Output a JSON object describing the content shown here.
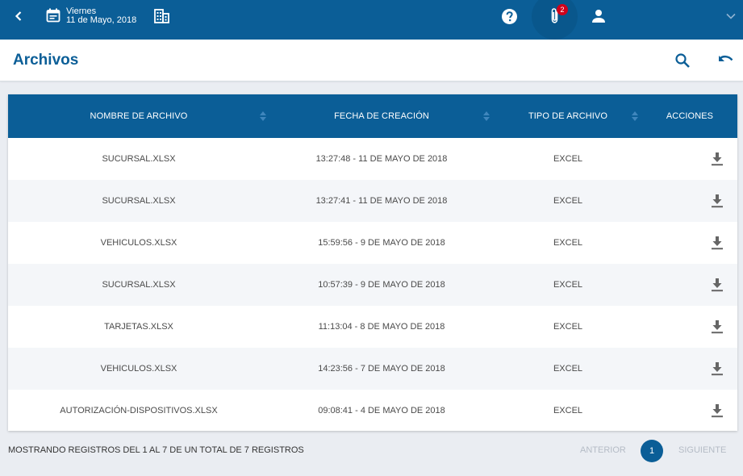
{
  "header": {
    "day": "Viernes",
    "date": "11 de Mayo, 2018",
    "attachments_badge": "2",
    "icons": [
      "back-icon",
      "calendar-icon",
      "building-icon",
      "help-icon",
      "paperclip-icon",
      "user-icon",
      "chevron-down-icon"
    ]
  },
  "page": {
    "title": "Archivos",
    "actions": [
      "search-icon",
      "undo-icon"
    ]
  },
  "table": {
    "columns": [
      "NOMBRE DE ARCHIVO",
      "FECHA DE CREACIÓN",
      "TIPO DE ARCHIVO",
      "ACCIONES"
    ],
    "rows": [
      {
        "name": "SUCURSAL.XLSX",
        "date": "13:27:48 - 11 DE MAYO DE 2018",
        "type": "EXCEL"
      },
      {
        "name": "SUCURSAL.XLSX",
        "date": "13:27:41 - 11 DE MAYO DE 2018",
        "type": "EXCEL"
      },
      {
        "name": "VEHICULOS.XLSX",
        "date": "15:59:56 - 9 DE MAYO DE 2018",
        "type": "EXCEL"
      },
      {
        "name": "SUCURSAL.XLSX",
        "date": "10:57:39 - 9 DE MAYO DE 2018",
        "type": "EXCEL"
      },
      {
        "name": "TARJETAS.XLSX",
        "date": "11:13:04 - 8 DE MAYO DE 2018",
        "type": "EXCEL"
      },
      {
        "name": "VEHICULOS.XLSX",
        "date": "14:23:56 - 7 DE MAYO DE 2018",
        "type": "EXCEL"
      },
      {
        "name": "AUTORIZACIÓN-DISPOSITIVOS.XLSX",
        "date": "09:08:41 - 4 DE MAYO DE 2018",
        "type": "EXCEL"
      }
    ]
  },
  "footer": {
    "info": "MOSTRANDO REGISTROS DEL 1 AL 7 DE UN TOTAL DE 7 REGISTROS",
    "prev": "ANTERIOR",
    "page": "1",
    "next": "SIGUIENTE"
  },
  "colors": {
    "primary": "#0b5e97",
    "badge": "#d0021b",
    "background": "#eaedf2"
  }
}
